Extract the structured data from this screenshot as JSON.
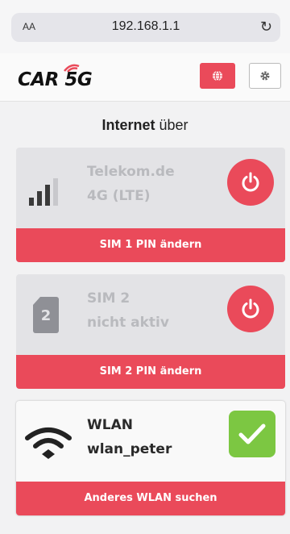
{
  "browser": {
    "text_size_label": "AA",
    "url": "192.168.1.1",
    "reload_icon": "reload-icon"
  },
  "header": {
    "logo_text": "CAR 5G",
    "globe_icon": "globe-icon",
    "settings_icon": "gear-icon",
    "accent_color": "#ea4a5a"
  },
  "title": {
    "bold": "Internet",
    "rest": " über"
  },
  "cards": [
    {
      "line1": "Telekom.de",
      "line2": "4G (LTE)",
      "icon": "signal-bars-icon",
      "action_icon": "power-icon",
      "footer": "SIM 1 PIN ändern",
      "active": false
    },
    {
      "line1": "SIM 2",
      "line2": "nicht aktiv",
      "icon": "sim-card-icon",
      "sim_number": "2",
      "action_icon": "power-icon",
      "footer": "SIM 2 PIN ändern",
      "active": false
    },
    {
      "line1": "WLAN",
      "line2": "wlan_peter",
      "icon": "wifi-icon",
      "action_icon": "check-icon",
      "footer": "Anderes WLAN suchen",
      "active": true,
      "active_color": "#7cc742"
    }
  ]
}
